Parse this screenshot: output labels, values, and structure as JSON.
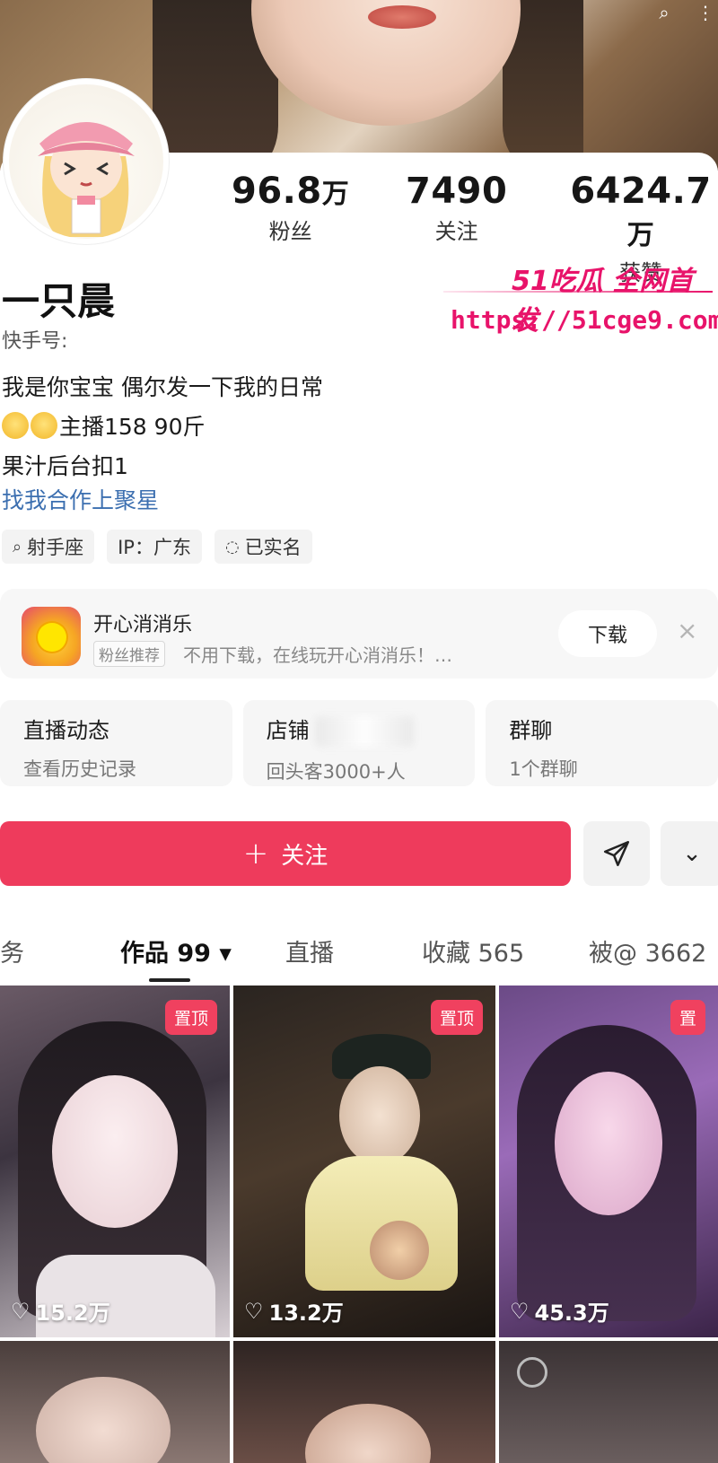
{
  "profile": {
    "stats": [
      {
        "value": "96.8",
        "unit": "万",
        "label": "粉丝"
      },
      {
        "value": "7490",
        "unit": "",
        "label": "关注"
      },
      {
        "value": "6424.7",
        "unit": "万",
        "label": "获赞"
      }
    ],
    "username": "一只晨",
    "kuaishou_id_label": "快手号:",
    "bio_line1": "我是你宝宝  偶尔发一下我的日常",
    "bio_line2": "主播158 90斤",
    "bio_line3": "果汁后台扣1",
    "collab_link": "找我合作上聚星",
    "tags": [
      {
        "icon": "search-icon",
        "glyph": "⌕",
        "label": "射手座"
      },
      {
        "icon": "ip-label",
        "glyph": "",
        "label": "IP：广东"
      },
      {
        "icon": "shield-check-icon",
        "glyph": "◌",
        "label": "已实名"
      }
    ]
  },
  "watermark": {
    "line1": "51吃瓜 全网首发",
    "line2": "https://51cge9.com"
  },
  "ad": {
    "title": "开心消消乐",
    "badge": "粉丝推荐",
    "description": "不用下载，在线玩开心消消乐！…",
    "button": "下载",
    "close": "×"
  },
  "features": [
    {
      "title": "直播动态",
      "subtitle": "查看历史记录"
    },
    {
      "title": "店铺",
      "subtitle": "回头客3000+人"
    },
    {
      "title": "群聊",
      "subtitle": "1个群聊"
    }
  ],
  "actions": {
    "follow_plus": "+",
    "follow_label": "关注",
    "more": "⌄"
  },
  "tabs": [
    {
      "label": "服务",
      "partial": "务"
    },
    {
      "label": "作品 99 ▾"
    },
    {
      "label": "直播"
    },
    {
      "label": "收藏 565"
    },
    {
      "label": "被@ 3662"
    }
  ],
  "videos": [
    {
      "pinned": true,
      "pin_label": "置顶",
      "likes": "15.2万"
    },
    {
      "pinned": true,
      "pin_label": "置顶",
      "likes": "13.2万"
    },
    {
      "pinned": true,
      "pin_label": "置",
      "likes": "45.3万"
    }
  ],
  "colors": {
    "accent": "#ee3b5c",
    "link": "#3c6fb0",
    "watermark": "#e8136a"
  }
}
